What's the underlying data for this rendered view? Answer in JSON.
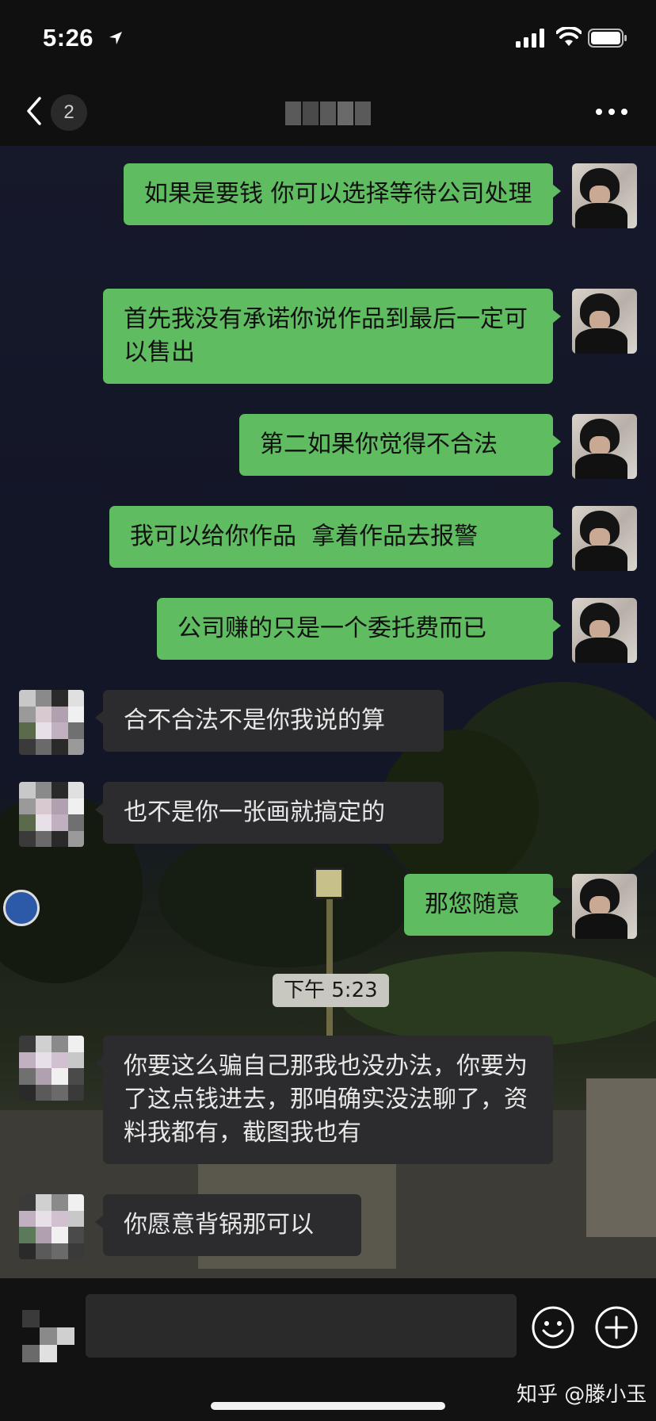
{
  "status_bar": {
    "time": "5:26"
  },
  "nav": {
    "unread_count": "2"
  },
  "messages": [
    {
      "side": "out",
      "text": "如果是要钱 你可以选择等待公司处理"
    },
    {
      "side": "out",
      "text": "首先我没有承诺你说作品到最后一定可以售出"
    },
    {
      "side": "out",
      "text": "第二如果你觉得不合法"
    },
    {
      "side": "out",
      "text": "我可以给你作品  拿着作品去报警"
    },
    {
      "side": "out",
      "text": "公司赚的只是一个委托费而已"
    },
    {
      "side": "in",
      "text": "合不合法不是你我说的算"
    },
    {
      "side": "in",
      "text": "也不是你一张画就搞定的"
    },
    {
      "side": "out",
      "text": "那您随意"
    },
    {
      "side": "in",
      "text": "你要这么骗自己那我也没办法，你要为了这点钱进去，那咱确实没法聊了，资料我都有，截图我也有"
    },
    {
      "side": "in",
      "text": "你愿意背锅那可以"
    }
  ],
  "time_divider": "下午 5:23",
  "input": {
    "value": ""
  },
  "watermark": "知乎 @滕小玉",
  "colors": {
    "outgoing_bubble": "#5fbc60",
    "incoming_bubble": "#2c2c2e",
    "bar_background": "#101010"
  }
}
